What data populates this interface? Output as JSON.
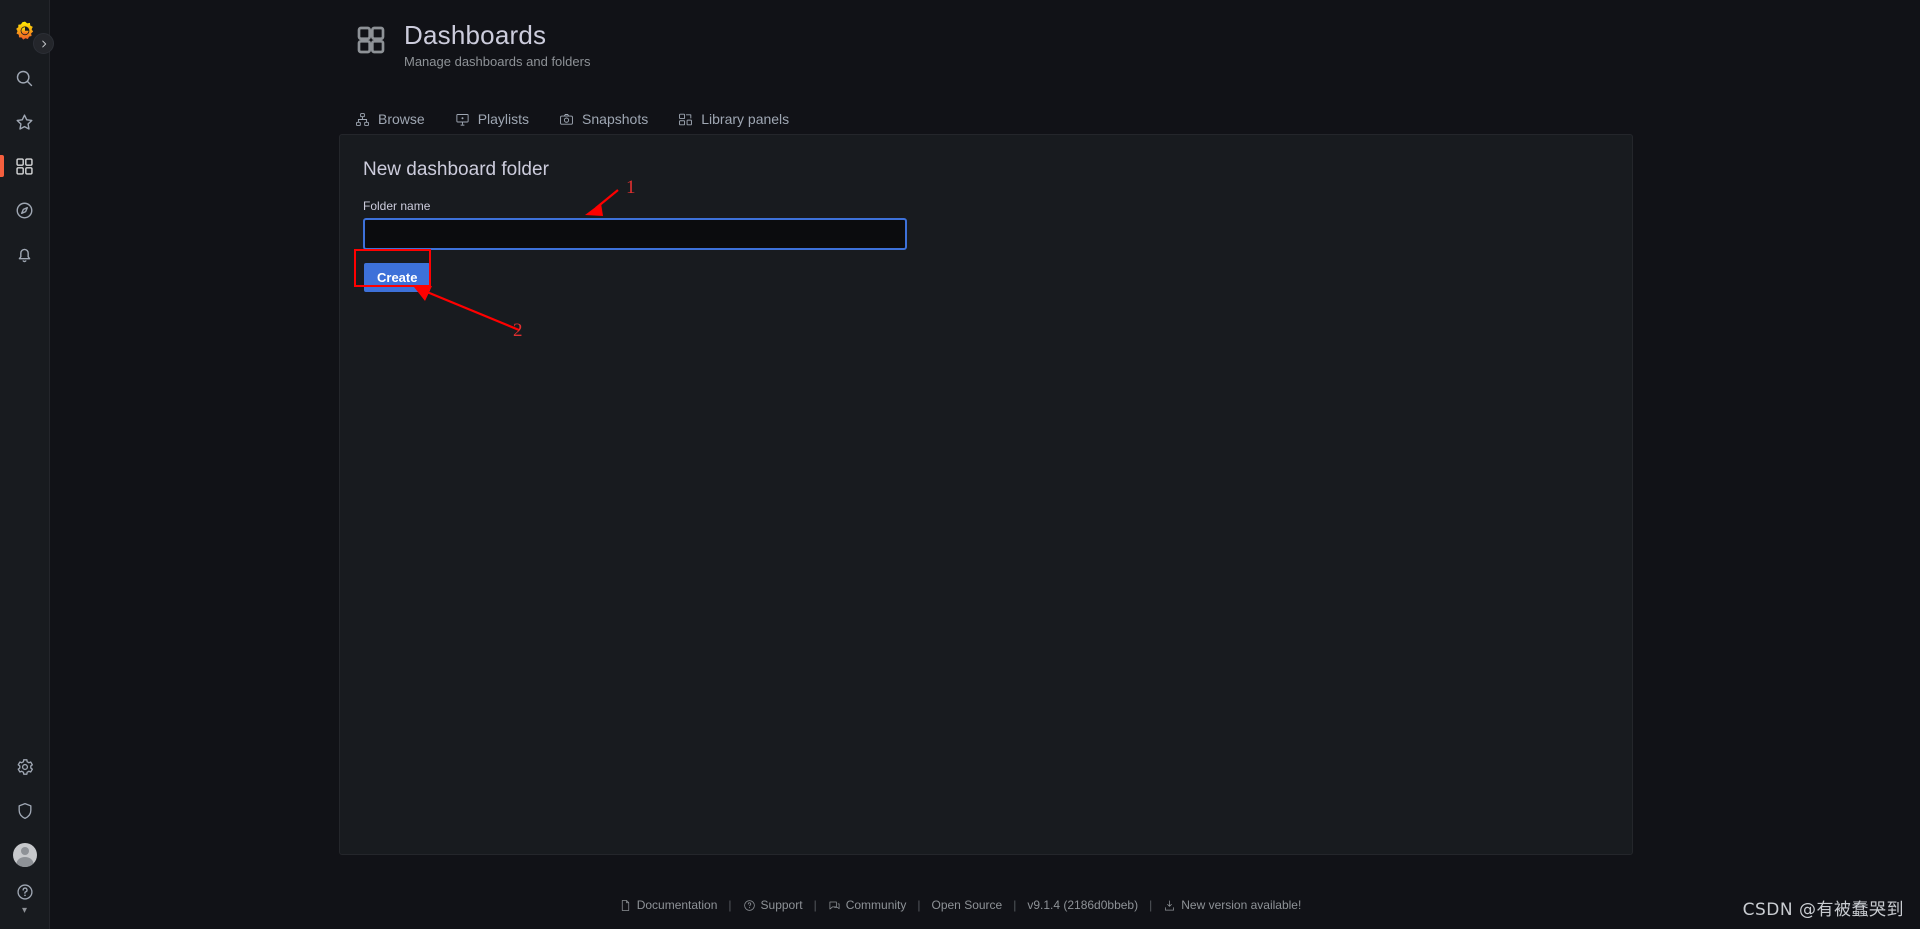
{
  "sidebar": {
    "logo_icon": "grafana-logo-icon",
    "expand_label": "chevron-right-icon",
    "items": [
      {
        "name": "search",
        "icon": "search-icon",
        "active": false
      },
      {
        "name": "starred",
        "icon": "star-icon",
        "active": false
      },
      {
        "name": "dashboards",
        "icon": "dashboards-grid-icon",
        "active": true
      },
      {
        "name": "explore",
        "icon": "compass-icon",
        "active": false
      },
      {
        "name": "alerting",
        "icon": "bell-icon",
        "active": false
      }
    ],
    "bottom_items": [
      {
        "name": "configuration",
        "icon": "gear-icon"
      },
      {
        "name": "server-admin",
        "icon": "shield-icon"
      },
      {
        "name": "profile",
        "icon": "avatar-icon"
      },
      {
        "name": "help",
        "icon": "question-circle-icon"
      }
    ]
  },
  "header": {
    "icon": "dashboards-grid-icon",
    "title": "Dashboards",
    "subtitle": "Manage dashboards and folders"
  },
  "tabs": [
    {
      "label": "Browse",
      "icon": "sitemap-icon",
      "active": false
    },
    {
      "label": "Playlists",
      "icon": "presentation-icon",
      "active": false
    },
    {
      "label": "Snapshots",
      "icon": "camera-icon",
      "active": false
    },
    {
      "label": "Library panels",
      "icon": "library-panels-icon",
      "active": false
    }
  ],
  "panel": {
    "title": "New dashboard folder",
    "field_label": "Folder name",
    "input_value": "",
    "input_placeholder": "",
    "create_label": "Create"
  },
  "annotations": [
    {
      "number": "1",
      "target": "folder-name-input",
      "color": "#e03030"
    },
    {
      "number": "2",
      "target": "create-button",
      "color": "#e03030"
    }
  ],
  "footer": {
    "documentation": "Documentation",
    "support": "Support",
    "community": "Community",
    "open_source": "Open Source",
    "version": "v9.1.4 (2186d0bbeb)",
    "new_version": "New version available!",
    "separator": "|"
  },
  "watermark": "CSDN @有被蠢哭到",
  "colors": {
    "accent_blue": "#3d71d9",
    "active_orange": "#f55f3e",
    "annotation_red": "#ff0000",
    "panel_bg": "#181b1f",
    "page_bg": "#111217"
  }
}
